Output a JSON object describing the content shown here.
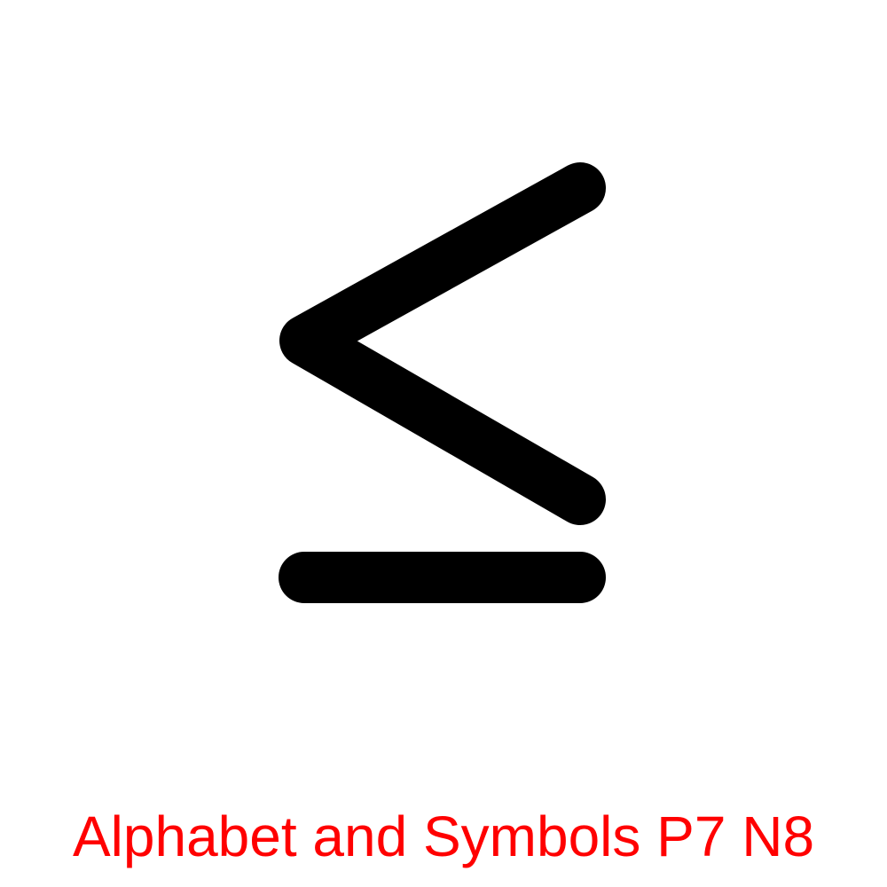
{
  "symbol": {
    "icon": "less-than-or-equal-icon",
    "color": "#000000"
  },
  "caption": {
    "text": "Alphabet and Symbols P7 N8",
    "color": "#ff0000"
  },
  "background": "#ffffff"
}
